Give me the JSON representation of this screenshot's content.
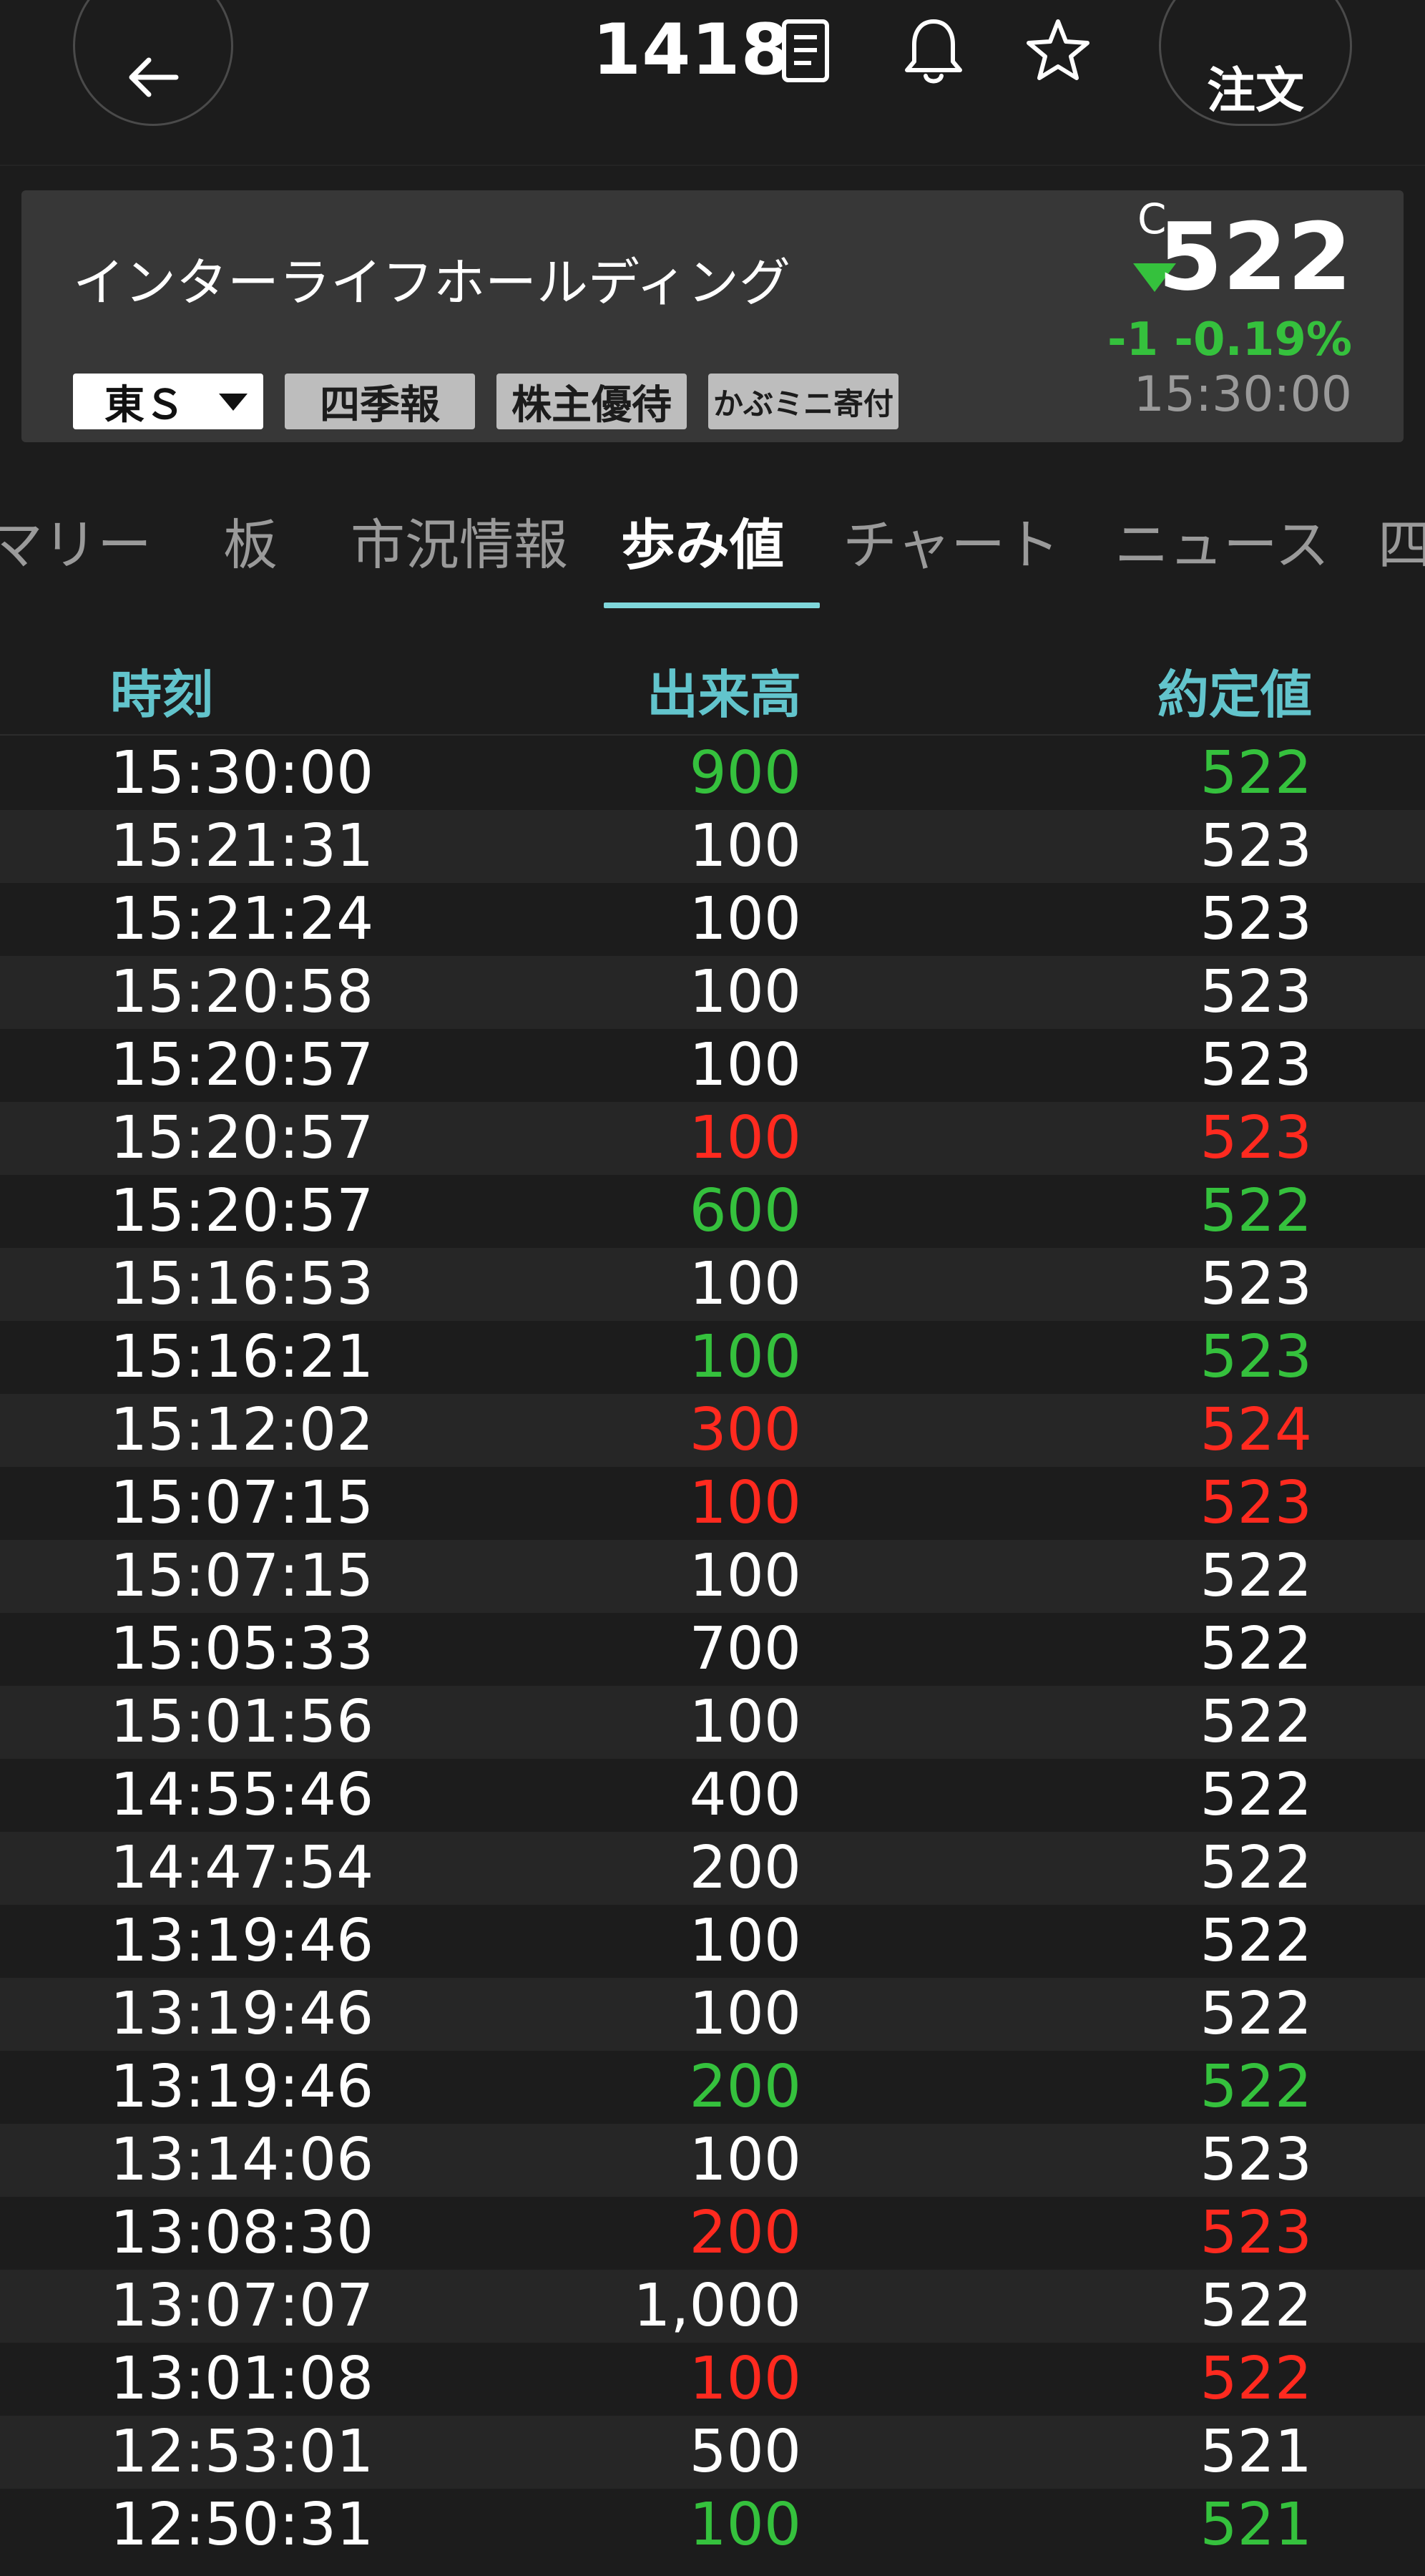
{
  "header": {
    "code": "1418",
    "order_label": "注文"
  },
  "stock": {
    "name": "インターライフホールディング",
    "c_mark": "C",
    "price": "522",
    "change": "-1  -0.19%",
    "time": "15:30:00",
    "market": "東Ｓ",
    "tags": [
      "四季報",
      "株主優待",
      "かぶミニ寄付"
    ]
  },
  "tabs": [
    "マリー",
    "板",
    "市況情報",
    "歩み値",
    "チャート",
    "ニュース",
    "四"
  ],
  "active_tab": "歩み値",
  "table": {
    "headers": {
      "time": "時刻",
      "volume": "出来高",
      "price": "約定値"
    },
    "rows": [
      {
        "time": "15:30:00",
        "volume": "900",
        "price": "522",
        "color": "green"
      },
      {
        "time": "15:21:31",
        "volume": "100",
        "price": "523",
        "color": "white"
      },
      {
        "time": "15:21:24",
        "volume": "100",
        "price": "523",
        "color": "white"
      },
      {
        "time": "15:20:58",
        "volume": "100",
        "price": "523",
        "color": "white"
      },
      {
        "time": "15:20:57",
        "volume": "100",
        "price": "523",
        "color": "white"
      },
      {
        "time": "15:20:57",
        "volume": "100",
        "price": "523",
        "color": "red"
      },
      {
        "time": "15:20:57",
        "volume": "600",
        "price": "522",
        "color": "green"
      },
      {
        "time": "15:16:53",
        "volume": "100",
        "price": "523",
        "color": "white"
      },
      {
        "time": "15:16:21",
        "volume": "100",
        "price": "523",
        "color": "green"
      },
      {
        "time": "15:12:02",
        "volume": "300",
        "price": "524",
        "color": "red"
      },
      {
        "time": "15:07:15",
        "volume": "100",
        "price": "523",
        "color": "red"
      },
      {
        "time": "15:07:15",
        "volume": "100",
        "price": "522",
        "color": "white"
      },
      {
        "time": "15:05:33",
        "volume": "700",
        "price": "522",
        "color": "white"
      },
      {
        "time": "15:01:56",
        "volume": "100",
        "price": "522",
        "color": "white"
      },
      {
        "time": "14:55:46",
        "volume": "400",
        "price": "522",
        "color": "white"
      },
      {
        "time": "14:47:54",
        "volume": "200",
        "price": "522",
        "color": "white"
      },
      {
        "time": "13:19:46",
        "volume": "100",
        "price": "522",
        "color": "white"
      },
      {
        "time": "13:19:46",
        "volume": "100",
        "price": "522",
        "color": "white"
      },
      {
        "time": "13:19:46",
        "volume": "200",
        "price": "522",
        "color": "green"
      },
      {
        "time": "13:14:06",
        "volume": "100",
        "price": "523",
        "color": "white"
      },
      {
        "time": "13:08:30",
        "volume": "200",
        "price": "523",
        "color": "red"
      },
      {
        "time": "13:07:07",
        "volume": "1,000",
        "price": "522",
        "color": "white"
      },
      {
        "time": "13:01:08",
        "volume": "100",
        "price": "522",
        "color": "red"
      },
      {
        "time": "12:53:01",
        "volume": "500",
        "price": "521",
        "color": "white"
      },
      {
        "time": "12:50:31",
        "volume": "100",
        "price": "521",
        "color": "green"
      }
    ]
  },
  "colors": {
    "up": "#ff2a1f",
    "down": "#35c13d",
    "neutral": "#ffffff",
    "accent": "#62c4cc",
    "tab_underline": "#7fd6da"
  },
  "icons": {
    "back": "back-arrow-icon",
    "doc": "document-icon",
    "bell": "bell-icon",
    "star": "star-icon",
    "market_caret": "caret-down-icon",
    "price_direction": "triangle-down-icon"
  }
}
